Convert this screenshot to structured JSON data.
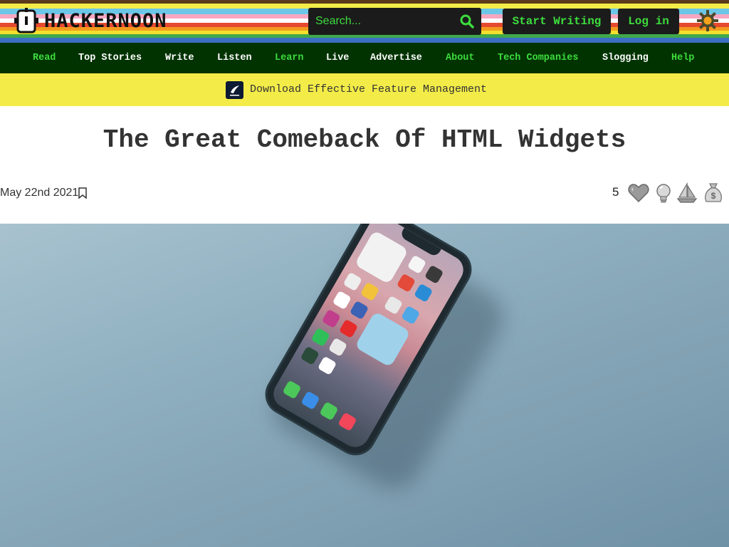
{
  "header": {
    "logo_text": "HACKERNOON",
    "search_placeholder": "Search...",
    "start_writing": "Start Writing",
    "login": "Log in"
  },
  "nav": {
    "items": [
      {
        "label": "Read"
      },
      {
        "label": "Top Stories"
      },
      {
        "label": "Write"
      },
      {
        "label": "Listen"
      },
      {
        "label": "Learn"
      },
      {
        "label": "Live"
      },
      {
        "label": "Advertise"
      },
      {
        "label": "About"
      },
      {
        "label": "Tech Companies"
      },
      {
        "label": "Slogging"
      },
      {
        "label": "Help"
      }
    ]
  },
  "promo": {
    "text": "Download Effective Feature Management"
  },
  "article": {
    "title": "The Great Comeback Of HTML Widgets",
    "date": "May 22nd 2021",
    "reaction_count": "5"
  },
  "icons": {
    "search": "search-icon",
    "theme": "gear-icon",
    "bookmark": "bookmark-icon",
    "reactions": [
      "heart-icon",
      "lightbulb-icon",
      "sailboat-icon",
      "money-bag-icon"
    ]
  },
  "colors": {
    "nav_bg": "#003300",
    "accent_green": "#3ddc3d",
    "promo_bg": "#f3ec48",
    "button_bg": "#1b1b1b"
  }
}
